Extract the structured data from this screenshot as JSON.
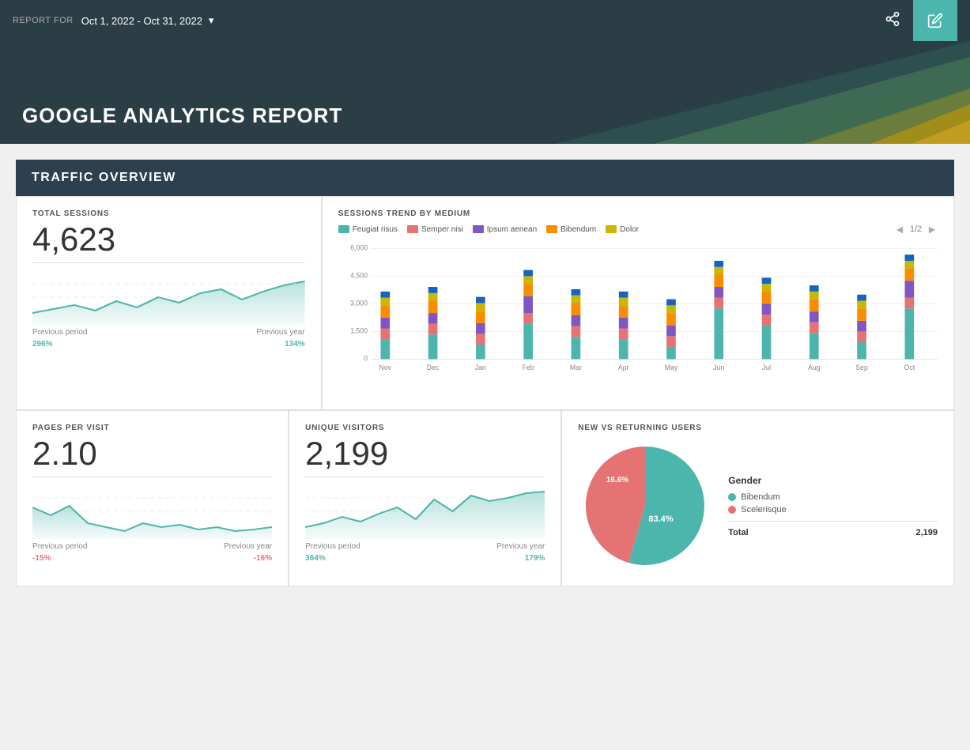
{
  "topbar": {
    "report_for_label": "REPORT FOR",
    "date_range": "Oct 1, 2022 - Oct 31, 2022",
    "share_icon": "⎋",
    "edit_icon": "✏"
  },
  "header": {
    "title": "GOOGLE ANALYTICS REPORT"
  },
  "section": {
    "title": "TRAFFIC OVERVIEW"
  },
  "total_sessions": {
    "label": "TOTAL SESSIONS",
    "value": "4,623",
    "previous_period_label": "Previous period",
    "previous_year_label": "Previous year",
    "previous_period_value": "296%",
    "previous_year_value": "134%"
  },
  "pages_per_visit": {
    "label": "PAGES PER VISIT",
    "value": "2.10",
    "previous_period_label": "Previous period",
    "previous_year_label": "Previous year",
    "previous_period_value": "-15%",
    "previous_year_value": "-16%"
  },
  "unique_visitors": {
    "label": "UNIQUE VISITORS",
    "value": "2,199",
    "previous_period_label": "Previous period",
    "previous_year_label": "Previous year",
    "previous_period_value": "364%",
    "previous_year_value": "179%"
  },
  "sessions_trend": {
    "label": "SESSIONS TREND BY MEDIUM",
    "page_indicator": "1/2",
    "legend": [
      {
        "name": "Feugiat risus",
        "color": "#4db6ac"
      },
      {
        "name": "Semper nisi",
        "color": "#e57373"
      },
      {
        "name": "Ipsum aenean",
        "color": "#7e57c2"
      },
      {
        "name": "Bibendum",
        "color": "#fb8c00"
      },
      {
        "name": "Dolor",
        "color": "#c9b700"
      }
    ],
    "months": [
      "Nov",
      "Dec",
      "Jan",
      "Feb",
      "Mar",
      "Apr",
      "May",
      "Jun",
      "Jul",
      "Aug",
      "Sep",
      "Oct"
    ],
    "y_labels": [
      "6,000",
      "4,500",
      "3,000",
      "1,500",
      "0"
    ]
  },
  "new_vs_returning": {
    "label": "NEW VS RETURNING USERS",
    "gender_title": "Gender",
    "legend": [
      {
        "name": "Bibendum",
        "color": "#4db6ac",
        "percent": 83.4
      },
      {
        "name": "Scelerisque",
        "color": "#e57373",
        "percent": 16.6
      }
    ],
    "total_label": "Total",
    "total_value": "2,199"
  },
  "colors": {
    "teal": "#4db6ac",
    "dark_header": "#2c3e45",
    "section_header": "#2c4050"
  }
}
